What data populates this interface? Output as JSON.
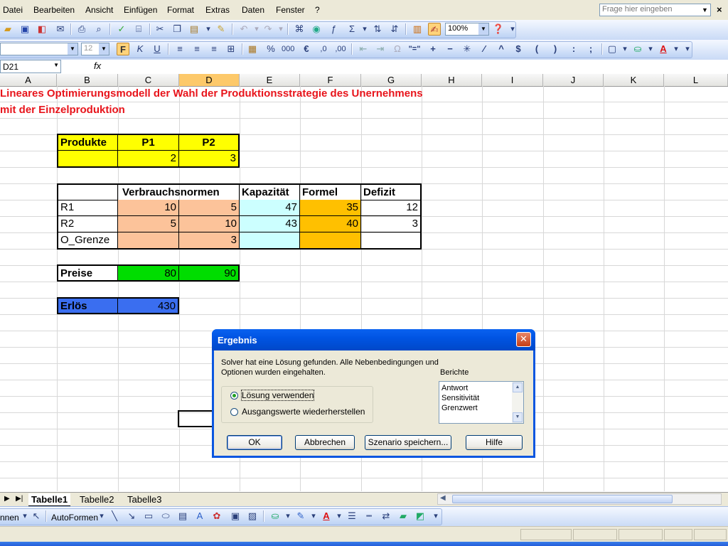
{
  "menu": [
    "Datei",
    "Bearbeiten",
    "Ansicht",
    "Einfügen",
    "Format",
    "Extras",
    "Daten",
    "Fenster",
    "?"
  ],
  "help_box": {
    "placeholder": "Frage hier eingeben"
  },
  "toolbar": {
    "zoom": "100%",
    "font_size": "12"
  },
  "name_box": "D21",
  "fx_label": "fx",
  "columns": [
    "A",
    "B",
    "C",
    "D",
    "E",
    "F",
    "G",
    "H",
    "I",
    "J",
    "K",
    "L"
  ],
  "selected_column": "D",
  "sheet": {
    "title_line1": "Lineares Optimierungsmodell der Wahl der Produktionsstrategie des Unernehmens",
    "title_line2": "mit der Einzelproduktion",
    "products": {
      "header": "Produkte",
      "p1": "P1",
      "p2": "P2",
      "v1": "2",
      "v2": "3"
    },
    "table": {
      "headers": [
        "Verbrauchsnormen",
        "Kapazität",
        "Formel",
        "Defizit"
      ],
      "rows": [
        {
          "name": "R1",
          "c": "10",
          "d": "5",
          "cap": "47",
          "formel": "35",
          "defizit": "12"
        },
        {
          "name": "R2",
          "c": "5",
          "d": "10",
          "cap": "43",
          "formel": "40",
          "defizit": "3"
        },
        {
          "name": "O_Grenze",
          "c": "",
          "d": "3",
          "cap": "",
          "formel": "",
          "defizit": ""
        }
      ]
    },
    "preise": {
      "label": "Preise",
      "p1": "80",
      "p2": "90"
    },
    "erloes": {
      "label": "Erlös",
      "value": "430"
    }
  },
  "sheet_tabs": [
    "Tabelle1",
    "Tabelle2",
    "Tabelle3"
  ],
  "active_tab": "Tabelle1",
  "drawbar": {
    "left_cut": "nnen",
    "autoformen": "AutoFormen"
  },
  "dialog": {
    "title": "Ergebnis",
    "close": "✕",
    "message": "Solver hat eine Lösung gefunden. Alle Nebenbedingungen und Optionen wurden eingehalten.",
    "radio_keep": "Lösung verwenden",
    "radio_restore": "Ausgangswerte wiederherstellen",
    "reports_label": "Berichte",
    "reports": [
      "Antwort",
      "Sensitivität",
      "Grenzwert"
    ],
    "buttons": {
      "ok": "OK",
      "cancel": "Abbrechen",
      "scenario": "Szenario speichern...",
      "help": "Hilfe"
    }
  },
  "colors": {
    "title_red": "#e8141b",
    "yellow": "#ffff00",
    "peach": "#fcc39a",
    "light_cyan": "#ccffff",
    "orange": "#ffc000",
    "green": "#00dd00",
    "blue": "#3a6ef0"
  }
}
